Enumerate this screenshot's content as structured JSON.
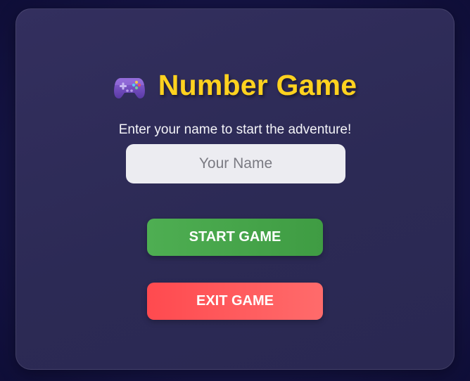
{
  "app": {
    "title": "Number Game",
    "title_icon": "gamepad-icon",
    "subtitle": "Enter your name to start the adventure!"
  },
  "form": {
    "name_placeholder": "Your Name",
    "name_value": ""
  },
  "actions": {
    "start_label": "START GAME",
    "exit_label": "EXIT GAME"
  },
  "colors": {
    "background": "#141342",
    "card": "#2e2b58",
    "title": "#ffd21f",
    "start_button": "#46a54a",
    "exit_button": "#ff5a5d",
    "input_background": "#ececf1"
  }
}
